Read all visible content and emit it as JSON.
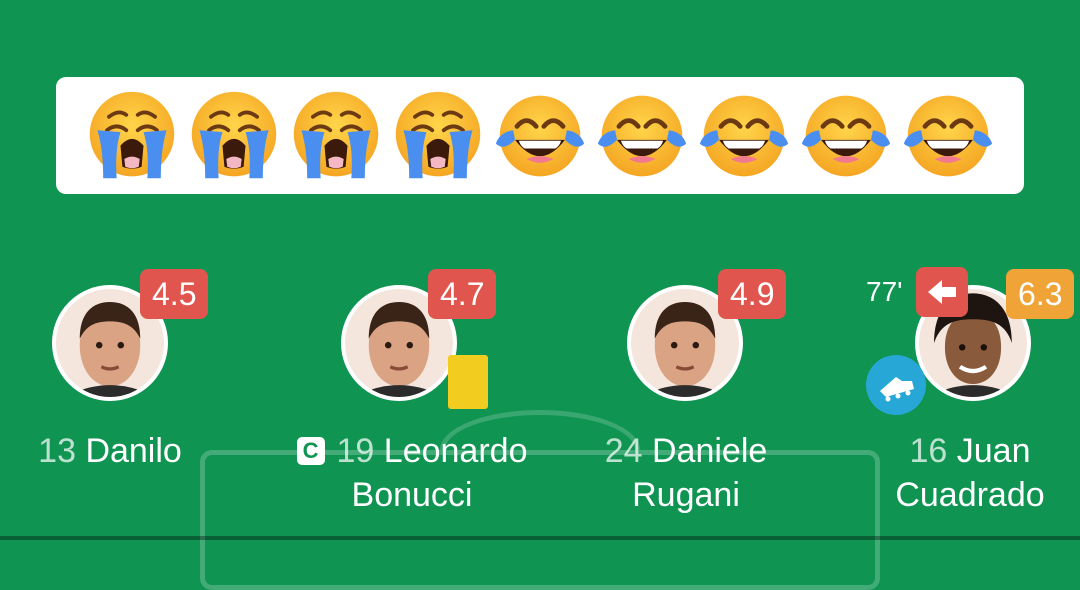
{
  "reactions": {
    "crying": {
      "count": 4,
      "icon": "loudly-crying-face-icon"
    },
    "laughing": {
      "count": 5,
      "icon": "face-with-tears-of-joy-icon"
    }
  },
  "players": [
    {
      "number": "13",
      "first_line": "Danilo",
      "second_line": "",
      "rating": "4.5",
      "rating_color": "#e0564e",
      "captain": false,
      "yellow_card": false,
      "substitution": null
    },
    {
      "number": "19",
      "first_line": "Leonardo",
      "second_line": "Bonucci",
      "rating": "4.7",
      "rating_color": "#e0564e",
      "captain": true,
      "captain_label": "C",
      "yellow_card": true,
      "substitution": null
    },
    {
      "number": "24",
      "first_line": "Daniele",
      "second_line": "Rugani",
      "rating": "4.9",
      "rating_color": "#e0564e",
      "captain": false,
      "yellow_card": false,
      "substitution": null
    },
    {
      "number": "16",
      "first_line": "Juan",
      "second_line": "Cuadrado",
      "rating": "6.3",
      "rating_color": "#f0a437",
      "captain": false,
      "yellow_card": false,
      "substitution": {
        "minute": "77'",
        "icon": "arrow-left-icon"
      },
      "badge_icon": "football-boot-icon"
    }
  ],
  "colors": {
    "pitch": "#0f9452",
    "rating_low": "#e0564e",
    "rating_mid": "#f0a437",
    "yellow_card": "#f2cd1f",
    "boot_badge": "#27a7d6"
  }
}
